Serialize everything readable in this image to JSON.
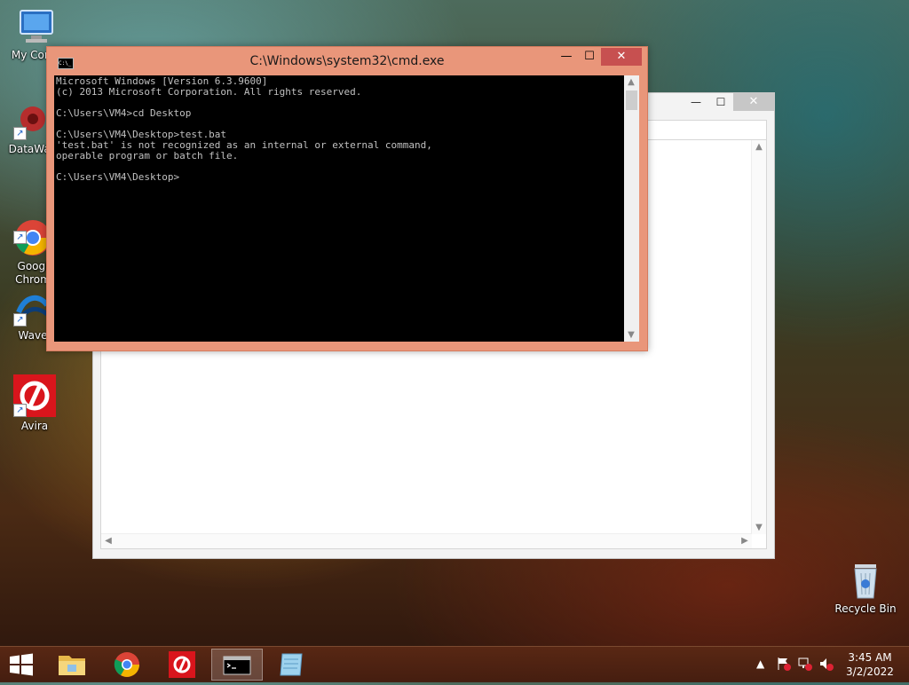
{
  "desktop_icons": [
    {
      "id": "my-computer",
      "label": "My Comp"
    },
    {
      "id": "datawag",
      "label": "DataWag"
    },
    {
      "id": "chrome",
      "label": "Googl\nChrom"
    },
    {
      "id": "wave",
      "label": "Wave"
    },
    {
      "id": "avira",
      "label": "Avira"
    },
    {
      "id": "recycle-bin",
      "label": "Recycle Bin"
    }
  ],
  "cmd_window": {
    "title": "C:\\Windows\\system32\\cmd.exe",
    "icon_text": "C:\\_",
    "buttons": {
      "minimize": "—",
      "maximize": "☐",
      "close": "✕"
    },
    "console_lines": [
      "Microsoft Windows [Version 6.3.9600]",
      "(c) 2013 Microsoft Corporation. All rights reserved.",
      "",
      "C:\\Users\\VM4>cd Desktop",
      "",
      "C:\\Users\\VM4\\Desktop>test.bat",
      "'test.bat' is not recognized as an internal or external command,",
      "operable program or batch file.",
      "",
      "C:\\Users\\VM4\\Desktop>"
    ]
  },
  "bg_window": {
    "buttons": {
      "minimize": "—",
      "maximize": "☐",
      "close": "✕"
    }
  },
  "taskbar": {
    "items": [
      "start",
      "file-explorer",
      "chrome",
      "avira",
      "cmd",
      "notepad"
    ],
    "active": "cmd",
    "clock": {
      "time": "3:45 AM",
      "date": "3/2/2022"
    },
    "tray": {
      "expand": "▲"
    }
  }
}
